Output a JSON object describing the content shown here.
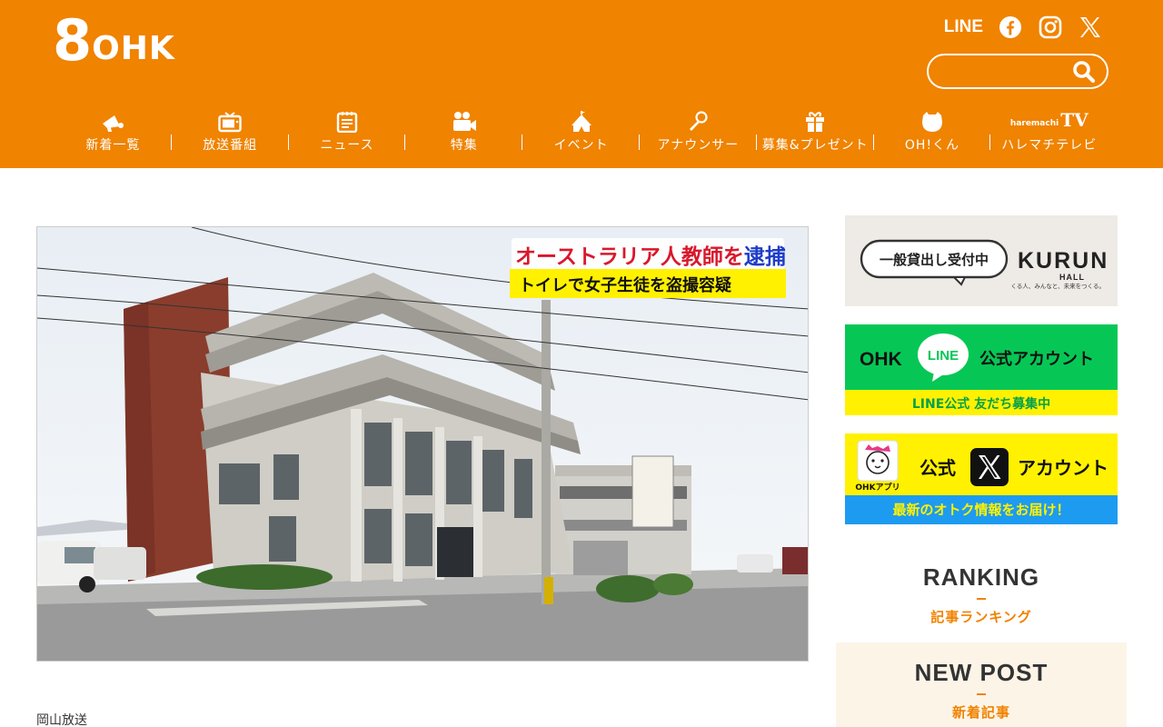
{
  "header": {
    "logo_number": "8",
    "logo_text": "OHK",
    "social": {
      "line_label": "LINE",
      "facebook_icon": "facebook-icon",
      "instagram_icon": "instagram-icon",
      "x_icon": "x-icon"
    },
    "search": {
      "value": "",
      "placeholder": ""
    },
    "nav": [
      {
        "label": "新着一覧",
        "icon": "megaphone-icon"
      },
      {
        "label": "放送番組",
        "icon": "tv-icon"
      },
      {
        "label": "ニュース",
        "icon": "notepad-icon"
      },
      {
        "label": "特集",
        "icon": "video-camera-icon"
      },
      {
        "label": "イベント",
        "icon": "tent-icon"
      },
      {
        "label": "アナウンサー",
        "icon": "microphone-icon"
      },
      {
        "label": "募集&プレゼント",
        "icon": "gift-icon"
      },
      {
        "label": "OH!くん",
        "icon": "mascot-icon"
      },
      {
        "label": "ハレマチテレビ",
        "icon": "harematchi-tv-logo",
        "logo_small": "haremachi",
        "logo_big": "TV"
      }
    ]
  },
  "hero": {
    "caption_line1_a": "オーストラリア人教師を",
    "caption_line1_b": "逮捕",
    "caption_line2": "トイレで女子生徒を盗撮容疑"
  },
  "article": {
    "source": "岡山放送"
  },
  "sidebar": {
    "kurun": {
      "badge": "一般貸出し受付中",
      "logo": "KURUN",
      "hall": "HALL",
      "tagline": "くる人、みんなと、未来をつくる。"
    },
    "line_banner": {
      "left": "OHK",
      "bubble": "LINE",
      "right": "公式アカウント",
      "bottom": "LINE公式 友だち募集中"
    },
    "x_banner": {
      "app_label": "OHKアプリ",
      "left": "公式",
      "right": "アカウント",
      "bottom": "最新のオトク情報をお届け！"
    },
    "ranking": {
      "title": "RANKING",
      "subtitle": "記事ランキング"
    },
    "newpost": {
      "title": "NEW POST",
      "subtitle": "新着記事"
    }
  },
  "colors": {
    "brand_orange": "#f08300",
    "line_green": "#06c755",
    "banner_yellow": "#fff100",
    "x_blue": "#1d9bf0"
  }
}
